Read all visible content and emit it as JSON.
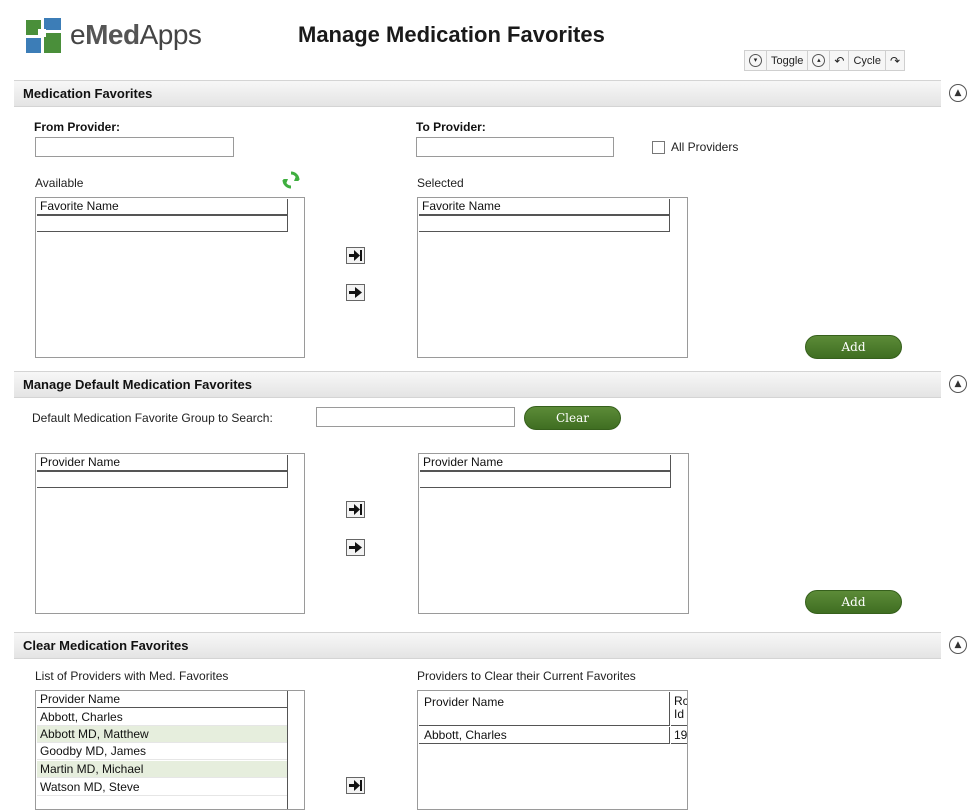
{
  "app": {
    "logo_text_prefix": "e",
    "logo_text_bold": "Med",
    "logo_text_suffix": "Apps",
    "page_title": "Manage Medication Favorites"
  },
  "toolbar": {
    "toggle_label": "Toggle",
    "cycle_label": "Cycle"
  },
  "sections": {
    "med_favorites": {
      "title": "Medication Favorites",
      "from_provider_label": "From Provider:",
      "from_provider_value": "",
      "to_provider_label": "To Provider:",
      "to_provider_value": "",
      "all_providers_label": "All Providers",
      "all_providers_checked": false,
      "available_label": "Available",
      "selected_label": "Selected",
      "available_header": "Favorite Name",
      "selected_header": "Favorite Name",
      "add_label": "Add"
    },
    "default_favorites": {
      "title": "Manage Default Medication Favorites",
      "search_label": "Default Medication Favorite Group to Search:",
      "search_value": "",
      "clear_label": "Clear",
      "left_header": "Provider Name",
      "right_header": "Provider Name",
      "add_label": "Add"
    },
    "clear_favorites": {
      "title": "Clear Medication Favorites",
      "left_label": "List of Providers with Med. Favorites",
      "right_label": "Providers to Clear their Current Favorites",
      "left_header": "Provider Name",
      "left_rows": [
        "Abbott, Charles",
        "Abbott MD, Matthew",
        "Goodby MD, James",
        "Martin MD, Michael",
        "Watson MD, Steve"
      ],
      "right_header_name": "Provider Name",
      "right_header_id_line1": "Rc",
      "right_header_id_line2": "Id",
      "right_rows": [
        {
          "name": "Abbott, Charles",
          "id": "19"
        }
      ]
    }
  },
  "colors": {
    "accent_green": "#4a7a2c",
    "selected_row": "#e6eedd",
    "refresh_icon": "#3fae3f"
  }
}
